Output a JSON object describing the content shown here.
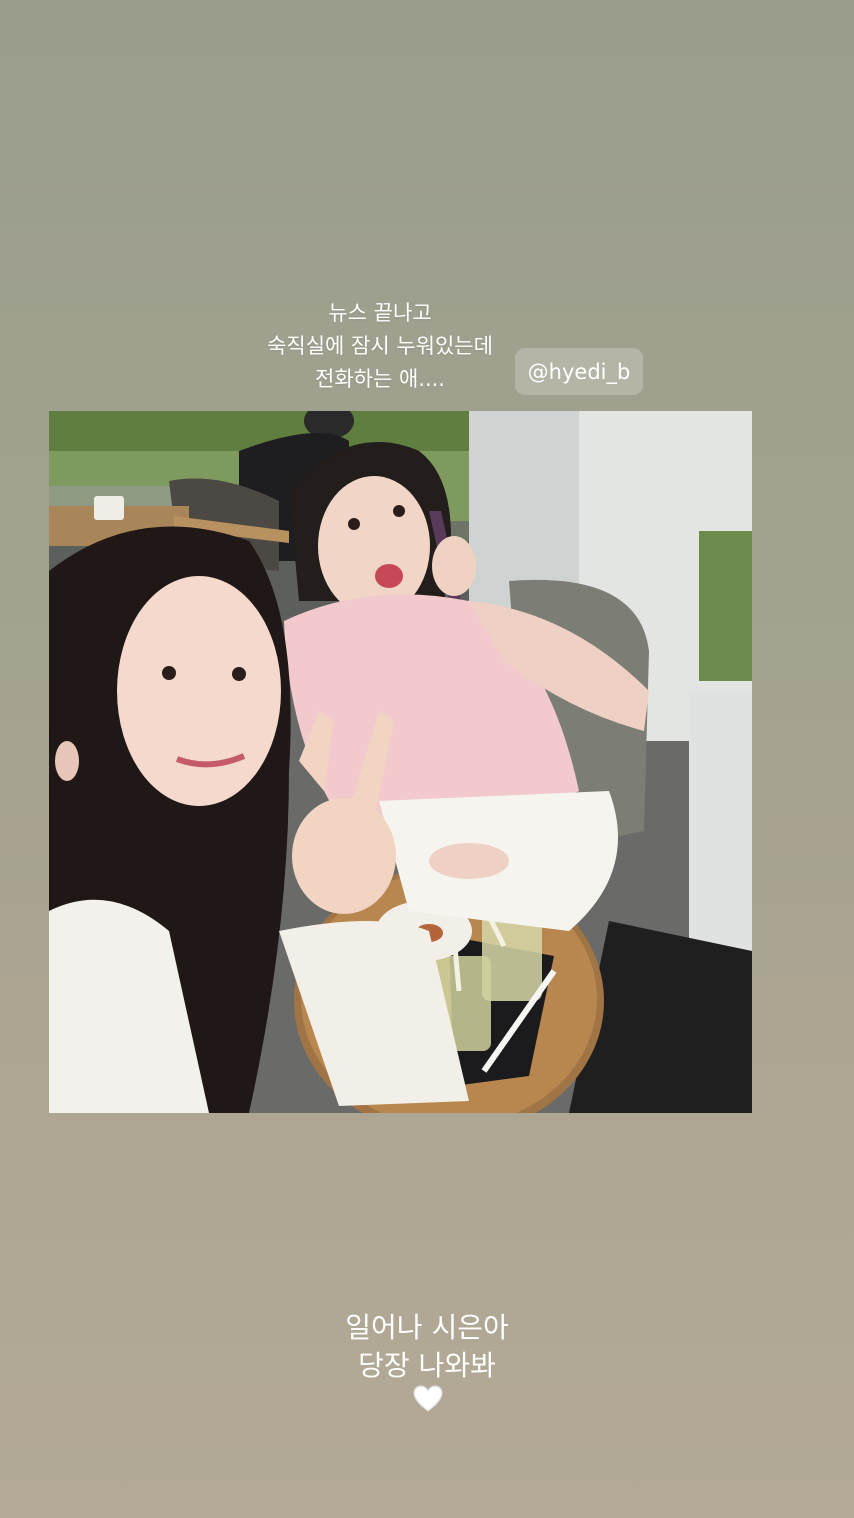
{
  "story": {
    "caption_top": {
      "line1": "뉴스 끝나고",
      "line2": "숙직실에 잠시 누워있는데",
      "line3": "전화하는 애...."
    },
    "mention": {
      "label": "@hyedi_b"
    },
    "photo": {
      "icon": "photo-image"
    },
    "caption_bottom": {
      "line1": "일어나 시은아",
      "line2": "당장 나와봐",
      "emoji_icon": "white-heart-icon"
    },
    "colors": {
      "background_top": "#9a9d8c",
      "background_bottom": "#b3a996",
      "text": "#ffffff",
      "sticker_bg": "rgba(255,255,255,0.22)"
    }
  }
}
